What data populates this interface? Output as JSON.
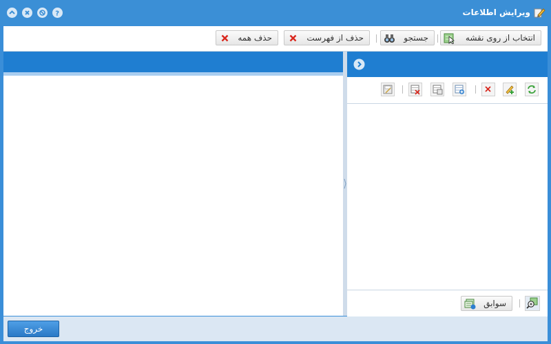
{
  "window": {
    "title": "ویرایش اطلاعات",
    "controls": [
      "up-icon",
      "close-icon",
      "block-icon",
      "help-icon"
    ]
  },
  "toolbar": {
    "select_on_map": "انتخاب از روی نقشه",
    "search": "جستجو",
    "remove_from_list": "حذف از فهرست",
    "remove_all": "حذف همه"
  },
  "right_panel": {
    "toolbar_icons": [
      "refresh-icon",
      "add-edit-icon",
      "delete-icon",
      "add-row-icon",
      "copy-row-icon",
      "remove-row-icon",
      "save-icon"
    ],
    "history_button": "سوابق"
  },
  "footer": {
    "exit_button": "خروج"
  },
  "colors": {
    "accent": "#3b8fd6",
    "panel_header": "#1f7ed1",
    "danger": "#d9261c"
  }
}
